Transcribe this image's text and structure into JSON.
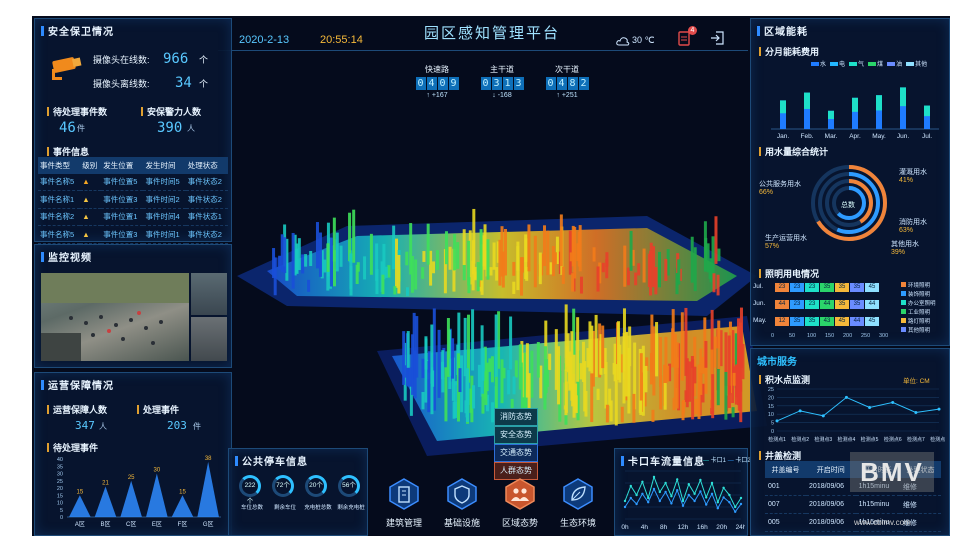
{
  "header": {
    "title": "园区感知管理平台",
    "date": "2020-2-13",
    "time": "20:55:14",
    "temperature": "30 ℃",
    "notification_count": "4"
  },
  "roads": [
    {
      "name": "快速路",
      "digits": [
        "0",
        "4",
        "0",
        "9"
      ],
      "delta": "↑ +167"
    },
    {
      "name": "主干道",
      "digits": [
        "0",
        "3",
        "1",
        "3"
      ],
      "delta": "↓ -168"
    },
    {
      "name": "次干道",
      "digits": [
        "0",
        "4",
        "8",
        "2"
      ],
      "delta": "↑ +251"
    }
  ],
  "security": {
    "title": "安全保卫情况",
    "cam_online_label": "摄像头在线数:",
    "cam_online_value": "966",
    "cam_offline_label": "摄像头离线数:",
    "cam_offline_value": "34",
    "unit_ge": "个",
    "pending_label": "待处理事件数",
    "pending_value": "46",
    "pending_unit": "件",
    "guards_label": "安保警力人数",
    "guards_value": "390",
    "guards_unit": "人",
    "events_title": "事件信息",
    "events_headers": [
      "事件类型",
      "级别",
      "发生位置",
      "发生时间",
      "处理状态"
    ],
    "events_rows": [
      [
        "事件名称5",
        "▲",
        "事件位置5",
        "事件时间5",
        "事件状态2"
      ],
      [
        "事件名称1",
        "▲",
        "事件位置3",
        "事件时间2",
        "事件状态2"
      ],
      [
        "事件名称2",
        "▲",
        "事件位置1",
        "事件时间4",
        "事件状态1"
      ],
      [
        "事件名称5",
        "▲",
        "事件位置3",
        "事件时间1",
        "事件状态2"
      ]
    ],
    "level_colors": [
      "#f5a623",
      "#f5c542",
      "#f5c542",
      "#f5c542"
    ]
  },
  "video": {
    "title": "监控视频"
  },
  "ops": {
    "title": "运营保障情况",
    "staff_label": "运营保障人数",
    "staff_value": "347",
    "staff_unit": "人",
    "handled_label": "处理事件",
    "handled_value": "203",
    "handled_unit": "件",
    "pending_title": "待处理事件"
  },
  "ops_chart": {
    "type": "bar",
    "categories": [
      "A区",
      "B区",
      "C区",
      "E区",
      "F区",
      "G区"
    ],
    "values": [
      15,
      21,
      25,
      30,
      15,
      38
    ],
    "ylim": [
      0,
      40
    ],
    "yticks": [
      0,
      5,
      10,
      15,
      20,
      25,
      30,
      35,
      40
    ]
  },
  "parking": {
    "title": "公共停车信息",
    "items": [
      {
        "value": "222",
        "unit": "个",
        "label": "车位总数"
      },
      {
        "value": "72",
        "unit": "个",
        "label": "剩余车位"
      },
      {
        "value": "20",
        "unit": "个",
        "label": "充电桩总数"
      },
      {
        "value": "56",
        "unit": "个",
        "label": "剩余充电桩"
      }
    ]
  },
  "center_buttons": [
    "消防态势",
    "安全态势",
    "交通态势",
    "人群态势"
  ],
  "nav": [
    "建筑管理",
    "基础设施",
    "区域态势",
    "生态环境"
  ],
  "traffic": {
    "title": "卡口车流量信息",
    "legend": [
      "卡口1",
      "卡口2"
    ]
  },
  "traffic_chart": {
    "type": "line",
    "x": [
      "0h",
      "4h",
      "8h",
      "12h",
      "16h",
      "20h",
      "24h"
    ],
    "xlabels": [
      "0h",
      "4h",
      "8h",
      "12h",
      "16h",
      "20h",
      "24h"
    ],
    "series": [
      {
        "name": "卡口1",
        "values": [
          30,
          55,
          40,
          62,
          35,
          70,
          45,
          60,
          38,
          66,
          30,
          58,
          42,
          65,
          36,
          60,
          28,
          52,
          40,
          20,
          35
        ]
      },
      {
        "name": "卡口2",
        "values": [
          20,
          35,
          25,
          42,
          28,
          50,
          30,
          45,
          26,
          48,
          22,
          40,
          30,
          46,
          24,
          42,
          18,
          36,
          28,
          12,
          25
        ]
      }
    ],
    "ylim": [
      0,
      80
    ],
    "colors": [
      "#2ee0d8",
      "#2e9bff"
    ]
  },
  "energy": {
    "title": "区域能耗",
    "monthly_title": "分月能耗费用",
    "legend": [
      "水",
      "电",
      "气",
      "煤",
      "油",
      "其他"
    ],
    "legend_colors": [
      "#1f7cff",
      "#23b7ff",
      "#1ee0c8",
      "#2bd46a",
      "#6a8cff",
      "#8fe0ff"
    ],
    "water_title": "用水量综合统计",
    "water_center": "总数",
    "water_items": [
      {
        "label": "公共服务用水",
        "pct": "66%"
      },
      {
        "label": "生产运营用水",
        "pct": "57%"
      },
      {
        "label": "灌溉用水",
        "pct": "41%"
      },
      {
        "label": "消防用水",
        "pct": "63%"
      },
      {
        "label": "其他用水",
        "pct": "39%"
      }
    ],
    "light_title": "照明用电情况",
    "light_legend": [
      "环境照明",
      "装饰照明",
      "办公室照明",
      "工业照明",
      "路灯照明",
      "其他照明"
    ]
  },
  "energy_chart": {
    "type": "bar",
    "categories": [
      "Jan.",
      "Feb.",
      "Mar.",
      "Apr.",
      "May.",
      "Jun.",
      "Jul."
    ],
    "values": [
      55,
      70,
      35,
      60,
      65,
      80,
      45
    ]
  },
  "light_chart": {
    "type": "bar",
    "categories": [
      "Jul.",
      "Jun.",
      "May."
    ],
    "series": [
      {
        "values": [
          "23",
          "23",
          "23",
          "35",
          "35",
          "35",
          "45"
        ]
      },
      {
        "values": [
          "44",
          "23",
          "23",
          "44",
          "35",
          "35",
          "44"
        ]
      },
      {
        "values": [
          "12",
          "35",
          "35",
          "43",
          "45",
          "44",
          "45"
        ]
      }
    ],
    "xticks": [
      "0",
      "50",
      "100",
      "150",
      "200",
      "250",
      "300"
    ]
  },
  "water_monitor": {
    "title": "积水点监测",
    "unit": "单位: CM",
    "service_label": "城市服务"
  },
  "water_chart": {
    "type": "line",
    "categories": [
      "检测点1",
      "检测点2",
      "检测点3",
      "检测点4",
      "检测点5",
      "检测点6",
      "检测点7",
      "检测点8"
    ],
    "values": [
      6,
      12,
      9,
      20,
      14,
      17,
      11,
      13
    ],
    "ylim": [
      0,
      25
    ],
    "yticks": [
      0,
      5,
      10,
      15,
      20,
      25
    ]
  },
  "well": {
    "title": "井盖检测",
    "headers": [
      "井盖编号",
      "开启时间",
      "开启时长",
      "处理状态"
    ],
    "rows": [
      [
        "001",
        "2018/09/06",
        "1h15minu",
        "维修"
      ],
      [
        "007",
        "2018/09/06",
        "1h15minu",
        "维修"
      ],
      [
        "005",
        "2018/09/06",
        "1h15minu",
        "维修"
      ]
    ]
  },
  "watermark": {
    "logo": "BMV",
    "url": "www.cbimv.com"
  }
}
